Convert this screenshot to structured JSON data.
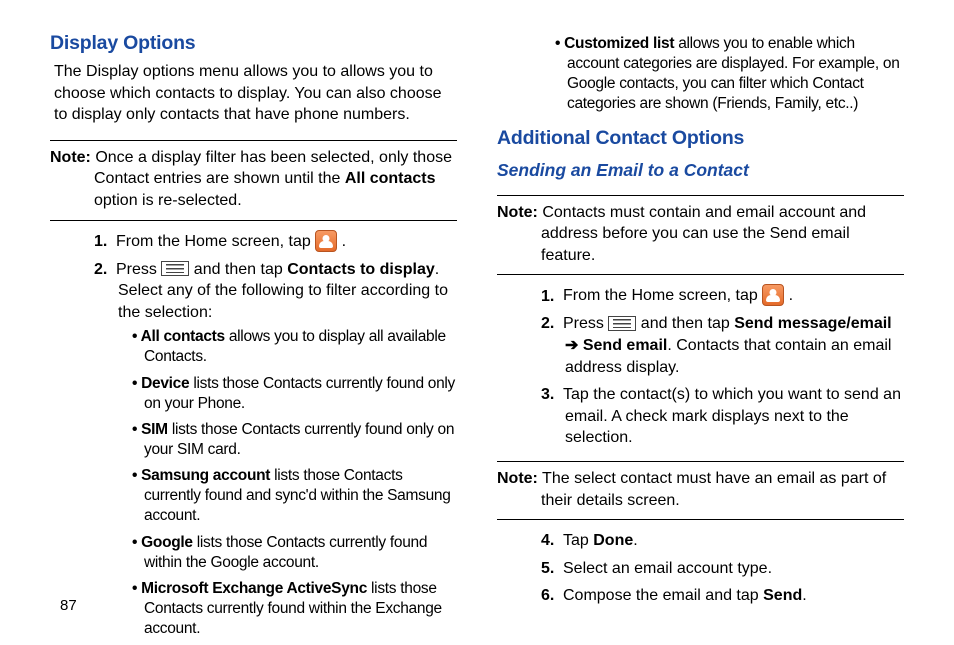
{
  "pageNumber": "87",
  "left": {
    "heading": "Display Options",
    "intro": "The Display options menu allows you to allows you to choose which contacts to display. You can also choose to display only contacts that have phone numbers.",
    "note1_label": "Note:",
    "note1_before": " Once a display filter has been selected, only those Contact entries are shown until the ",
    "note1_bold": "All contacts",
    "note1_after": " option is re-selected.",
    "step1_pre": "From the Home screen, tap  ",
    "step1_post": " .",
    "step2_pre": "Press  ",
    "step2_mid": "  and then tap ",
    "step2_bold": "Contacts to display",
    "step2_post": ". Select any of the following to filter according to the selection:",
    "b1_bold": "All contacts",
    "b1_rest": " allows you to display all available Contacts.",
    "b2_bold": "Device",
    "b2_rest": " lists those Contacts currently found only on your Phone.",
    "b3_bold": "SIM",
    "b3_rest": " lists those Contacts currently found only on your SIM card.",
    "b4_bold": "Samsung account",
    "b4_rest": " lists those Contacts currently found and sync'd within the Samsung account.",
    "b5_bold": "Google",
    "b5_rest": " lists those Contacts currently found within the Google account.",
    "b6_bold": "Microsoft Exchange ActiveSync",
    "b6_rest": " lists those Contacts currently found within the Exchange account."
  },
  "right": {
    "b7_bold": "Customized list",
    "b7_rest": " allows you to enable which account categories are displayed. For example, on Google contacts, you can filter which Contact categories are shown (Friends, Family, etc..)",
    "heading": "Additional Contact Options",
    "subheading": "Sending an Email to a Contact",
    "note1_label": "Note:",
    "note1_text": " Contacts must contain and email account and address before you can use the Send email feature.",
    "step1_pre": "From the Home screen, tap  ",
    "step1_post": " .",
    "step2_pre": "Press  ",
    "step2_mid": "  and then tap ",
    "step2_bold1": "Send message/email",
    "step2_arrow": " ➔ ",
    "step2_bold2": "Send email",
    "step2_post": ". Contacts that contain an email address display.",
    "step3": "Tap the contact(s) to which you want to send an email. A check mark displays next to the selection.",
    "note2_label": "Note:",
    "note2_text": " The select contact must have an email as part of their details screen.",
    "step4_pre": "Tap ",
    "step4_bold": "Done",
    "step4_post": ".",
    "step5": "Select an email account type.",
    "step6_pre": "Compose the email and tap ",
    "step6_bold": "Send",
    "step6_post": "."
  }
}
